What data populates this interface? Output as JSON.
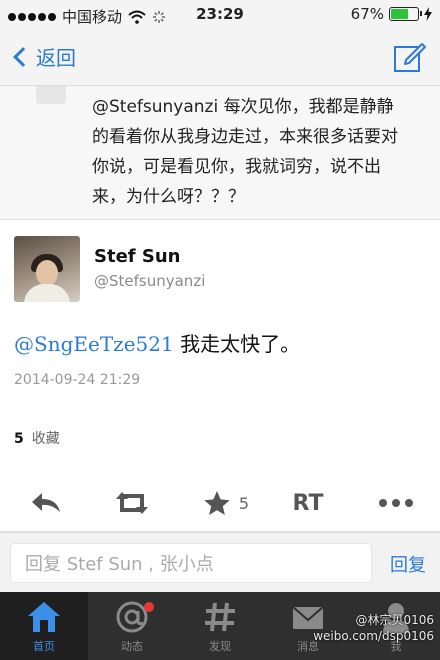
{
  "status_bar": {
    "carrier": "中国移动",
    "time": "23:29",
    "battery_percent": "67%",
    "battery_level": 0.67
  },
  "nav": {
    "back_label": "返回",
    "back_icon": "chevron-left-icon",
    "compose_icon": "compose-icon"
  },
  "quoted_comment": {
    "text": "@Stefsunyanzi 每次见你，我都是静静的看着你从我身边走过，本来很多话要对你说，可是看见你，我就词穷，说不出来，为什么呀？？？"
  },
  "post": {
    "author_name": "Stef Sun",
    "author_handle": "@Stefsunyanzi",
    "mention": "@SngEeTze521",
    "text": "我走太快了。",
    "timestamp": "2014-09-24 21:29",
    "favorites_count": "5",
    "favorites_label": "收藏"
  },
  "actions": {
    "star_count": "5",
    "rt_label": "RT"
  },
  "reply_bar": {
    "placeholder": "回复 Stef Sun , 张小点",
    "send_label": "回复"
  },
  "tabs": [
    {
      "label": "首页",
      "icon": "home-icon",
      "active": true
    },
    {
      "label": "动态",
      "icon": "at-icon",
      "badge": true
    },
    {
      "label": "发现",
      "icon": "hash-icon"
    },
    {
      "label": "消息",
      "icon": "mail-icon"
    },
    {
      "label": "我",
      "icon": "user-icon"
    }
  ],
  "watermark": {
    "line1": "@林宗贝0106",
    "line2": "weibo.com/dsp0106"
  },
  "colors": {
    "accent": "#2a7bd6",
    "tab_bar": "#2f2f2f",
    "battery": "#2ec23a",
    "badge": "#e53935"
  }
}
